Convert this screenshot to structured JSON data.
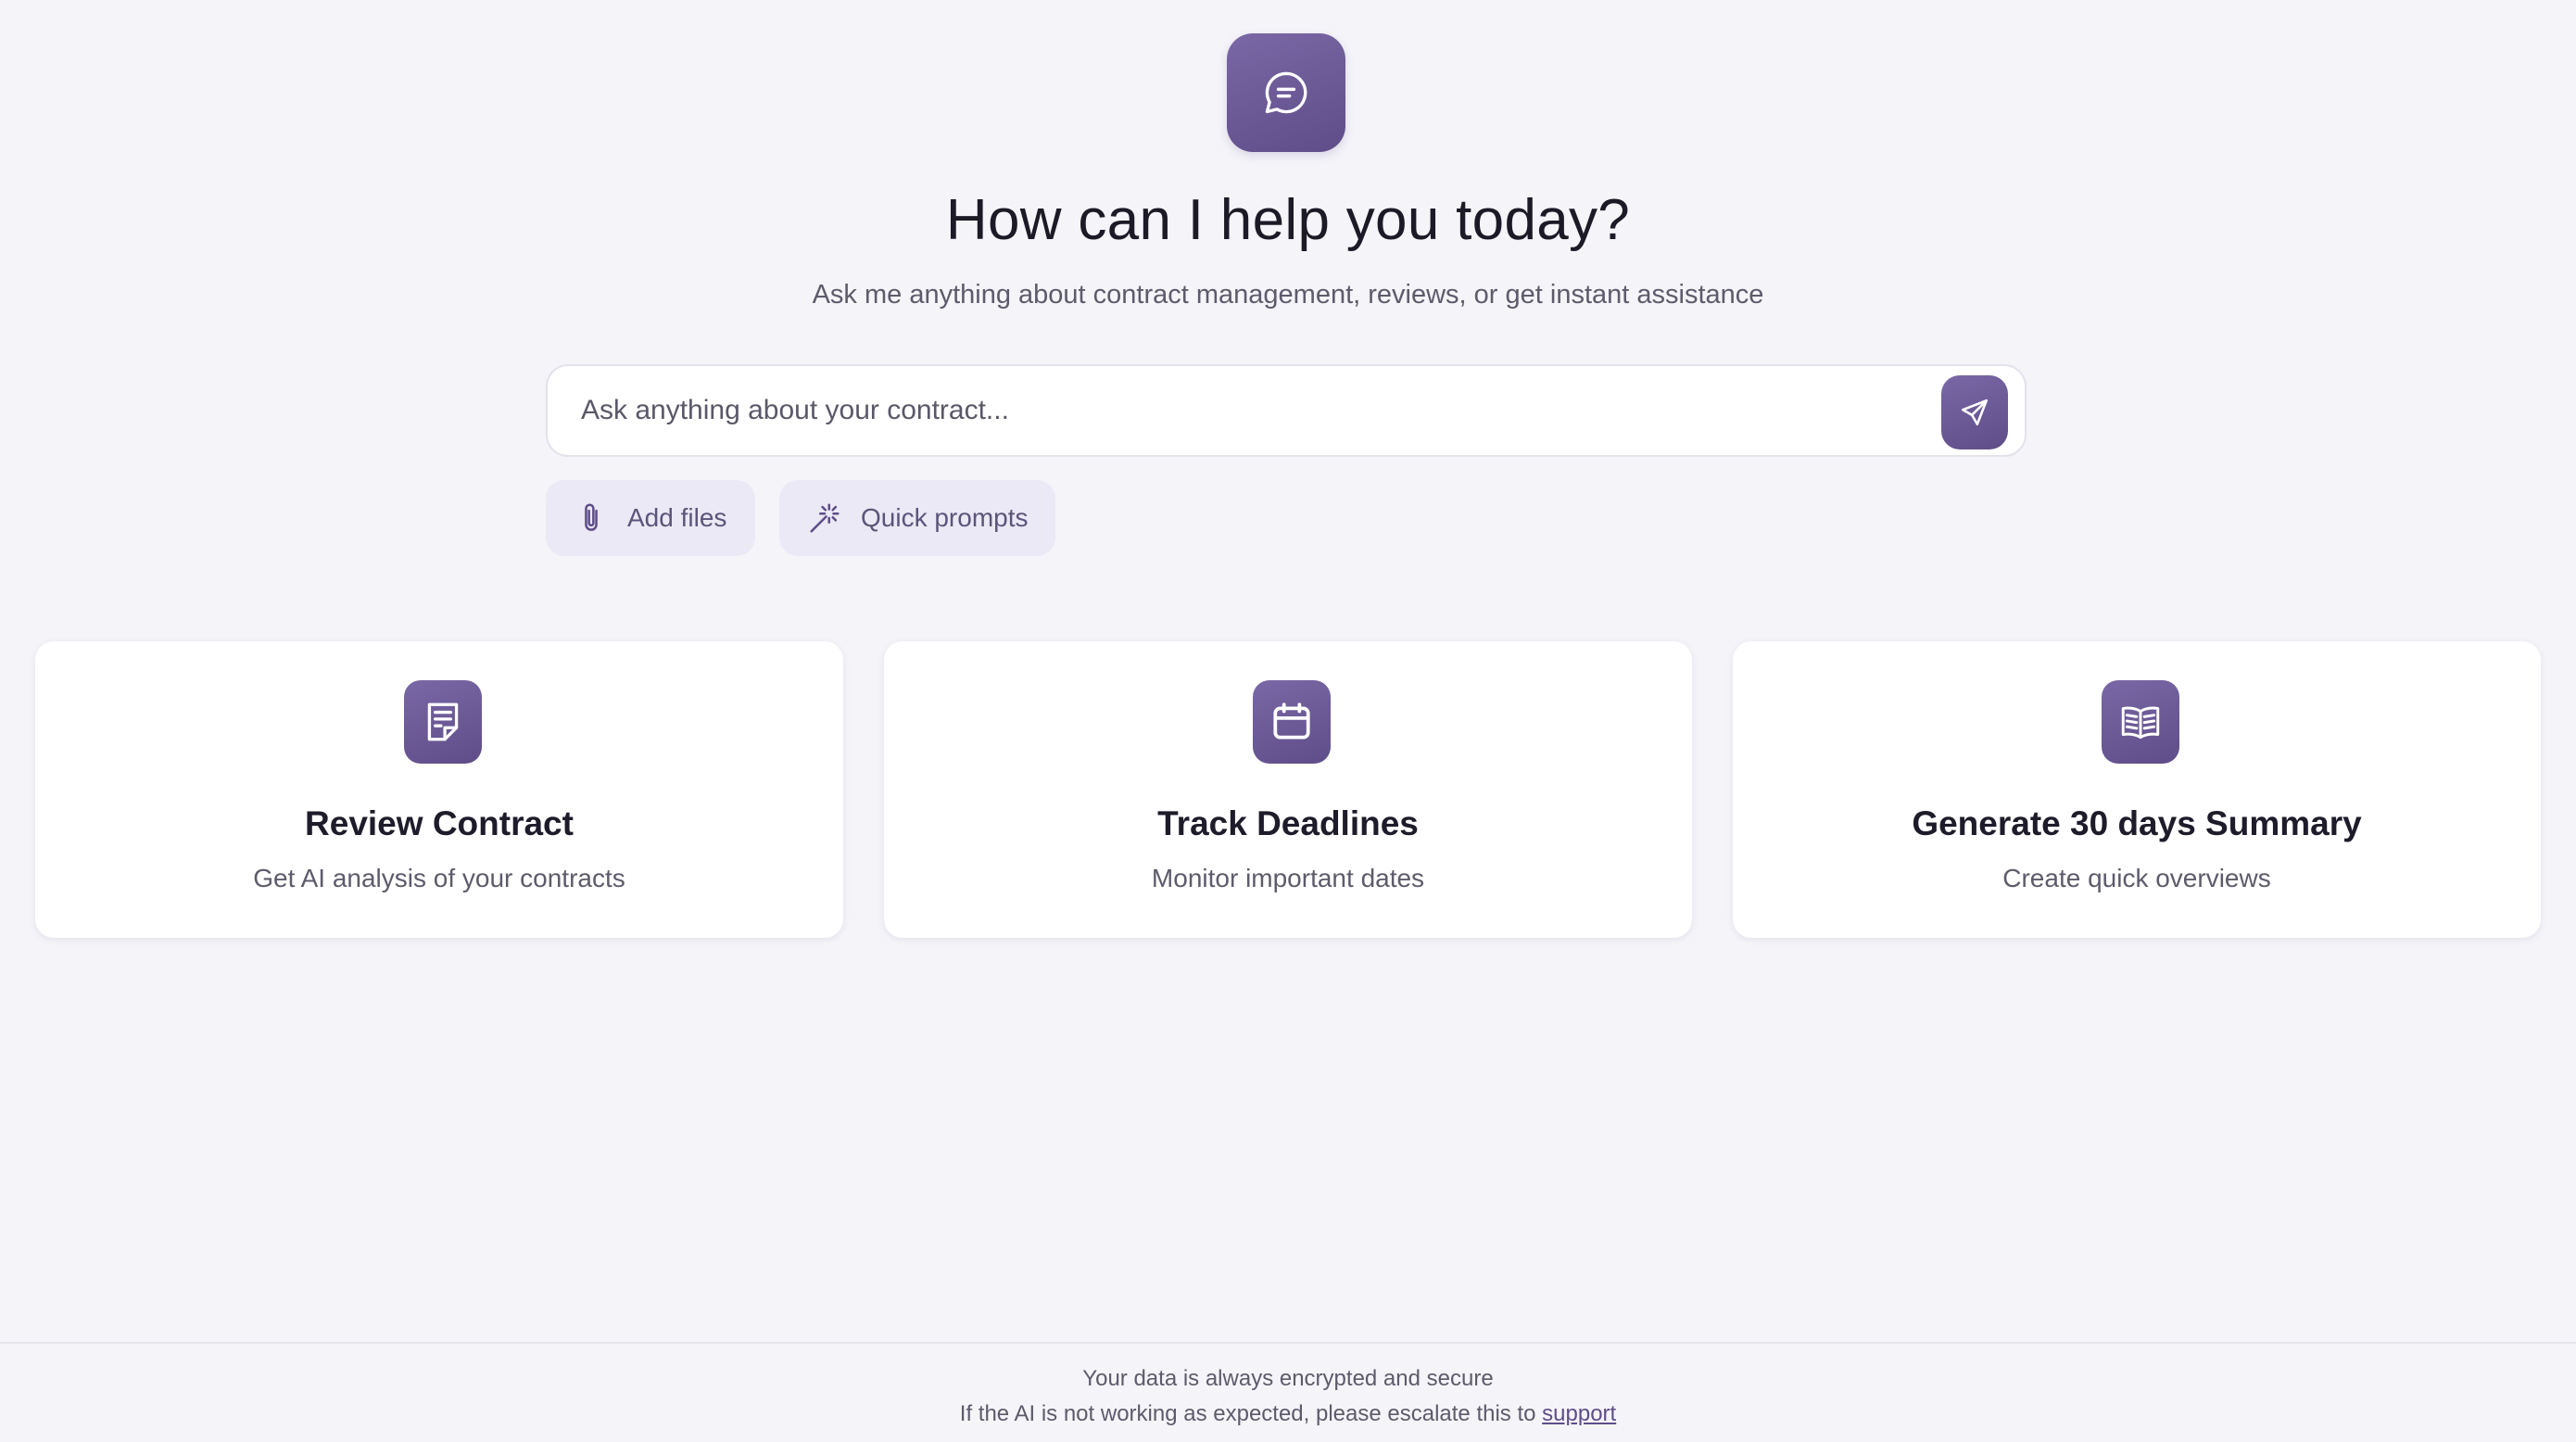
{
  "header": {
    "logo_icon": "chat-bubble-icon",
    "title": "How can I help you today?",
    "subtitle": "Ask me anything about contract management, reviews, or get instant assistance"
  },
  "search": {
    "placeholder": "Ask anything about your contract...",
    "value": "",
    "send_icon": "send-icon"
  },
  "chips": {
    "add_files": {
      "label": "Add files",
      "icon": "paperclip-icon"
    },
    "quick_prompts": {
      "label": "Quick prompts",
      "icon": "magic-wand-icon"
    }
  },
  "cards": [
    {
      "title": "Review Contract",
      "subtitle": "Get AI analysis of your contracts",
      "icon": "document-icon"
    },
    {
      "title": "Track Deadlines",
      "subtitle": "Monitor important dates",
      "icon": "calendar-icon"
    },
    {
      "title": "Generate 30 days Summary",
      "subtitle": "Create quick overviews",
      "icon": "book-icon"
    }
  ],
  "footer": {
    "security_note": "Your data is always encrypted and secure",
    "escalation_text": "If the AI is not working as expected, please escalate this to",
    "support_link": "support"
  },
  "colors": {
    "accent": "#6b5a96",
    "background": "#f5f4f9",
    "chip_background": "#ebe9f5"
  }
}
